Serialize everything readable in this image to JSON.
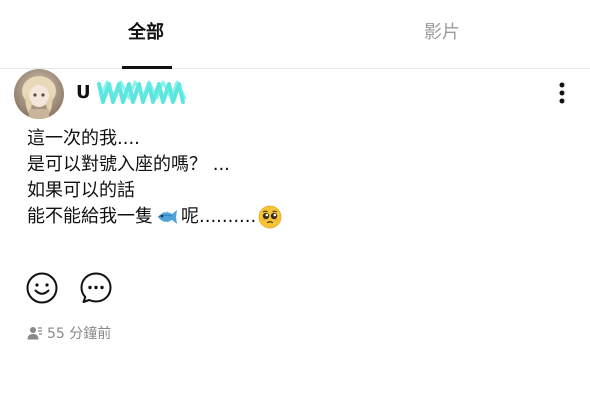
{
  "tabs": [
    {
      "label": "全部",
      "active": true
    },
    {
      "label": "影片",
      "active": false
    }
  ],
  "post": {
    "author_initial": "U",
    "lines": [
      "這一次的我....",
      "是可以對號入座的嗎？ ...",
      "如果可以的話"
    ],
    "last_line": {
      "before": "能不能給我一隻",
      "fish_emoji": "fish-icon",
      "middle": "呢..........",
      "face_emoji": "pleading-face-icon"
    },
    "meta_time": "55 分鐘前"
  },
  "colors": {
    "text": "#111111",
    "muted": "#8a8a8a",
    "inactive_tab": "#9b9b9b",
    "scribble": "#3fe0d8"
  }
}
